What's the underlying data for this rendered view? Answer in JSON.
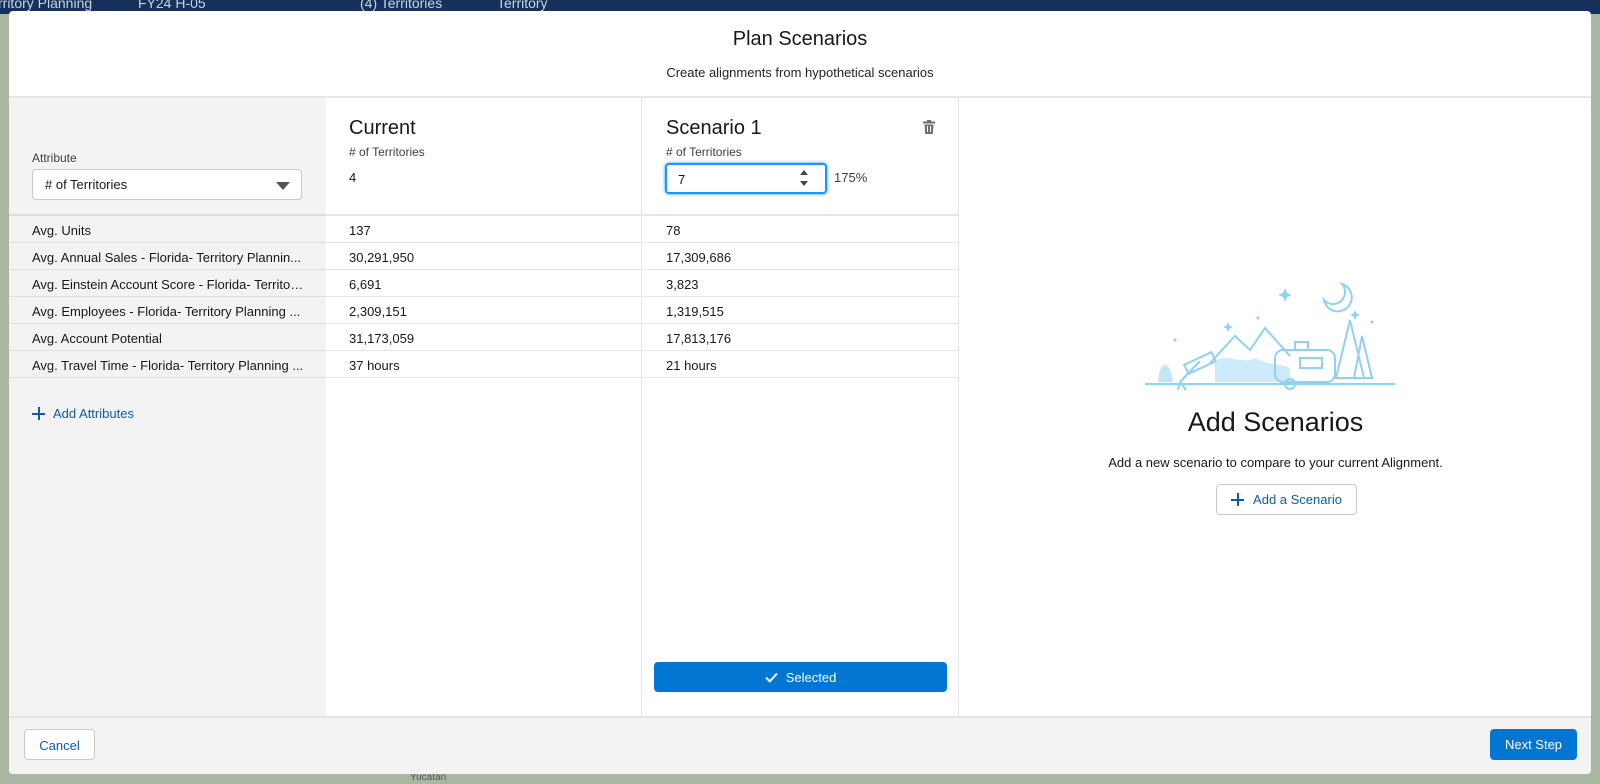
{
  "background": {
    "app_title": "rritory Planning",
    "tab_2": "FY24 H-05",
    "tab_3": "(4) Territories",
    "tab_4": "Territory",
    "map_label": "Yucatán"
  },
  "modal": {
    "title": "Plan Scenarios",
    "subtitle": "Create alignments from hypothetical scenarios"
  },
  "attribute_panel": {
    "label": "Attribute",
    "selected": "# of Territories",
    "rows": [
      "Avg. Units",
      "Avg. Annual Sales - Florida- Territory Plannin...",
      "Avg. Einstein Account Score - Florida- Territor...",
      "Avg. Employees - Florida- Territory Planning ...",
      "Avg. Account Potential",
      "Avg. Travel Time - Florida- Territory Planning ..."
    ],
    "add_attributes": "Add Attributes"
  },
  "current": {
    "title": "Current",
    "metric": "# of Territories",
    "value": "4",
    "rows": [
      "137",
      "30,291,950",
      "6,691",
      "2,309,151",
      "31,173,059",
      "37 hours"
    ]
  },
  "scenario_1": {
    "title": "Scenario 1",
    "metric": "# of Territories",
    "input_value": "7",
    "percent": "175%",
    "rows": [
      "78",
      "17,309,686",
      "3,823",
      "1,319,515",
      "17,813,176",
      "21 hours"
    ],
    "selected_label": "Selected",
    "icons": {
      "delete": "trash-icon",
      "selected": "check-icon"
    }
  },
  "empty_state": {
    "title": "Add Scenarios",
    "description": "Add a new scenario to compare to your current Alignment.",
    "button": "Add a Scenario",
    "illustration": "camping-illustration"
  },
  "footer": {
    "cancel": "Cancel",
    "next": "Next Step"
  },
  "colors": {
    "brand": "#0176d3",
    "link": "#0b5cab",
    "focus": "#1b96ff",
    "illustration": "#8fd0f5"
  }
}
